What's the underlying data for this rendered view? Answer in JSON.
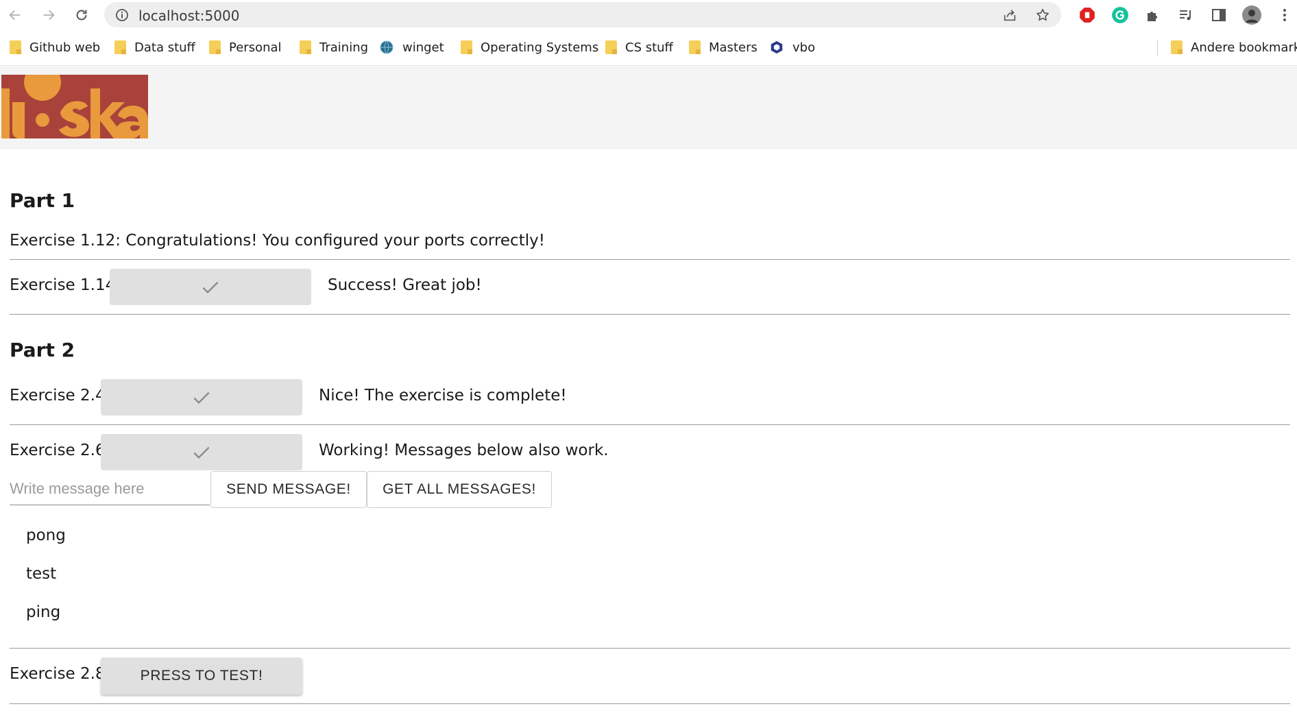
{
  "browser": {
    "url": "localhost:5000",
    "bookmarks": [
      {
        "label": "Github web",
        "icon": "folder-icon"
      },
      {
        "label": "Data stuff",
        "icon": "folder-icon"
      },
      {
        "label": "Personal",
        "icon": "folder-icon"
      },
      {
        "label": "Training",
        "icon": "folder-icon"
      },
      {
        "label": "winget",
        "icon": "globe-icon"
      },
      {
        "label": "Operating Systems",
        "icon": "folder-icon"
      },
      {
        "label": "CS stuff",
        "icon": "folder-icon"
      },
      {
        "label": "Masters",
        "icon": "folder-icon"
      },
      {
        "label": "vbo",
        "icon": "hexagon-icon"
      }
    ],
    "other_bookmarks": "Andere bookmarks"
  },
  "colors": {
    "logo_red": "#a8423a",
    "logo_orange": "#e89a3c",
    "header_bg": "#f4f4f4",
    "button_grey": "#e0e0e0"
  },
  "part1": {
    "title": "Part 1",
    "ex112": "Exercise 1.12: Congratulations! You configured your ports correctly!",
    "ex114_label": "Exercise 1.14:",
    "ex114_status": "Success! Great job!"
  },
  "part2": {
    "title": "Part 2",
    "ex24_label": "Exercise 2.4:",
    "ex24_status": "Nice! The exercise is complete!",
    "ex26_label": "Exercise 2.6:",
    "ex26_status": "Working! Messages below also work.",
    "message_placeholder": "Write message here",
    "send_button": "SEND MESSAGE!",
    "get_button": "GET ALL MESSAGES!",
    "messages": [
      "pong",
      "test",
      "ping"
    ],
    "ex28_label": "Exercise 2.8:",
    "ex28_button": "PRESS TO TEST!"
  }
}
